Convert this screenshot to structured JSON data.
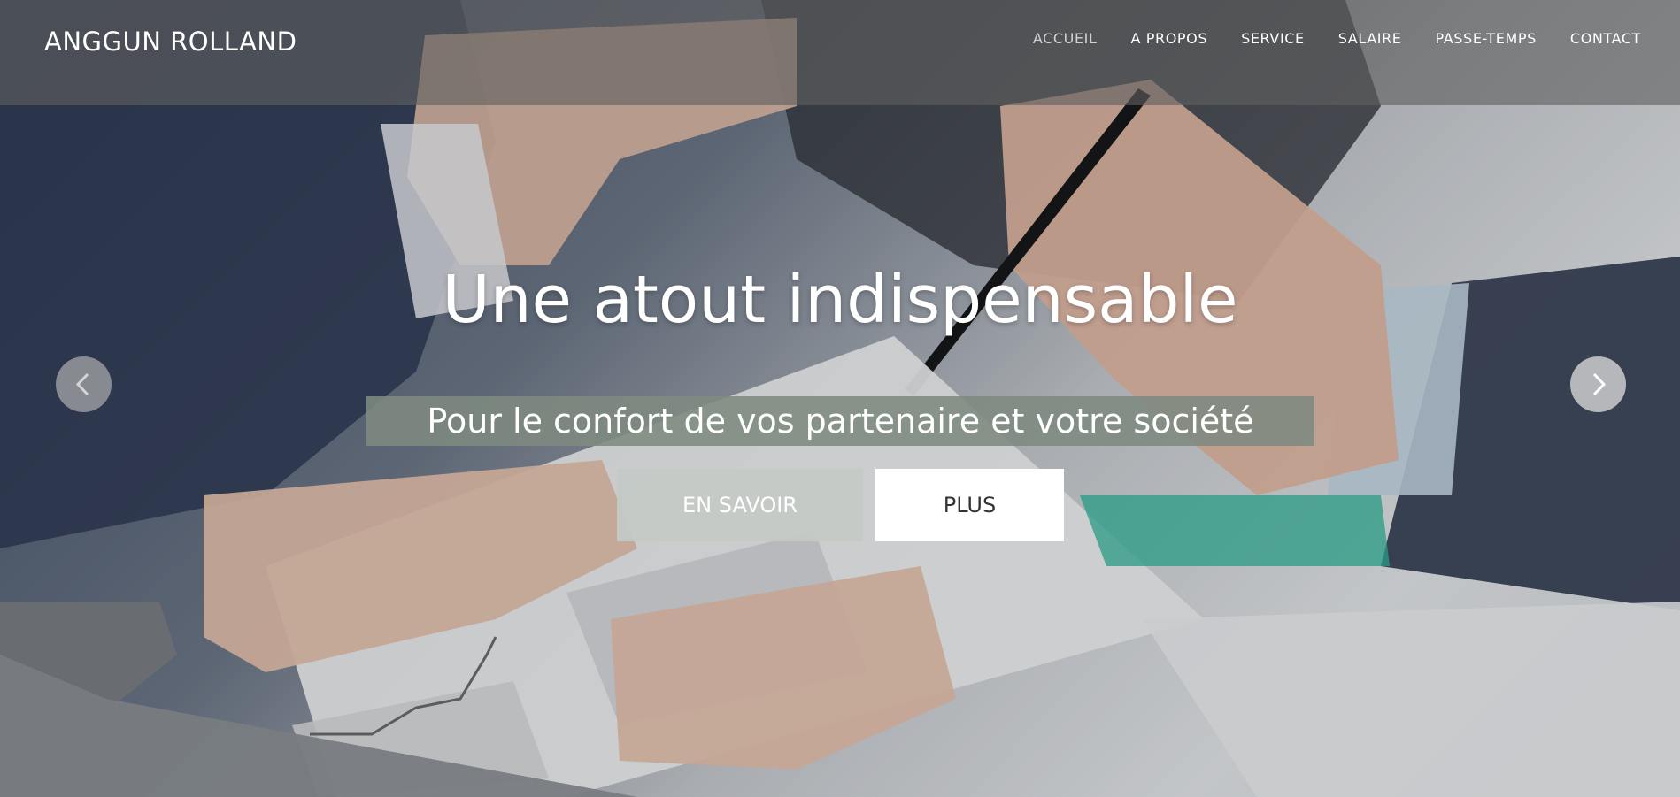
{
  "brand": {
    "name": "ANGGUN ROLLAND"
  },
  "nav": {
    "items": [
      {
        "label": "ACCUEIL",
        "active": true
      },
      {
        "label": "A PROPOS",
        "active": false
      },
      {
        "label": "SERVICE",
        "active": false
      },
      {
        "label": "SALAIRE",
        "active": false
      },
      {
        "label": "PASSE-TEMPS",
        "active": false
      },
      {
        "label": "CONTACT",
        "active": false
      }
    ]
  },
  "hero": {
    "title": "Une atout indispensable",
    "subtitle": "Pour le confort de vos partenaire et votre société",
    "buttons": {
      "learn_more": "EN SAVOIR",
      "plus": "PLUS"
    },
    "carousel": {
      "prev_icon": "chevron-left-icon",
      "next_icon": "chevron-right-icon"
    },
    "background_image": "business-meeting-photo"
  },
  "colors": {
    "nav_bg": "#5f5f5f",
    "subtitle_bg": "#7d8a80",
    "button_muted": "#c4c9c6",
    "button_white": "#ffffff"
  }
}
